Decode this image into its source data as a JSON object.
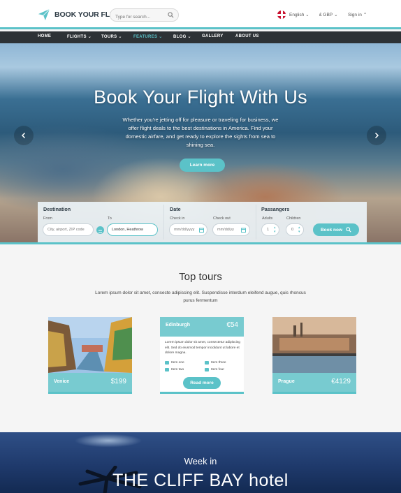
{
  "header": {
    "logo_text": "BOOK YOUR FLIGHT",
    "search_placeholder": "Type for search...",
    "language": "English",
    "currency": "£ GBP",
    "signin": "Sign in"
  },
  "nav": {
    "items": [
      "HOME",
      "FLIGHTS",
      "TOURS",
      "FEATURES",
      "BLOG",
      "GALLERY",
      "ABOUT US"
    ],
    "active": "FEATURES"
  },
  "hero": {
    "title": "Book Your Flight With Us",
    "text": "Whether you're jetting off for pleasure or traveling for business, we offer flight deals to the best destinations in America. Find your domestic airfare, and get ready to explore the sights from sea to shining sea.",
    "button": "Learn more"
  },
  "booking": {
    "destination_label": "Destination",
    "from_label": "From",
    "from_placeholder": "City, airport, ZIP code",
    "to_label": "To",
    "to_value": "London, Heathrow",
    "date_label": "Date",
    "checkin_label": "Check in",
    "checkin_placeholder": "mm/dd/yyyy",
    "checkout_label": "Check out",
    "checkout_placeholder": "mm/dd/yy",
    "passengers_label": "Passangers",
    "adults_label": "Adults",
    "adults_value": "1",
    "children_label": "Children",
    "children_value": "0",
    "book_button": "Book now"
  },
  "tours": {
    "title": "Top tours",
    "subtitle": "Lorem ipsum dolor sit amet, consecte adipiscing elit. Suspendisse interdum eleifend augue, quis rhoncus purus fermentum",
    "cards": [
      {
        "name": "Venice",
        "price": "$199"
      },
      {
        "name": "Edinburgh",
        "price": "€54",
        "description": "Lorem ipsum dolor sit amet, consectetur adipiscing elit. Sed do eiusmod tempor incididunt ut labore et dolore magna.",
        "features": [
          "Item one",
          "Item three",
          "Item two",
          "Item four"
        ],
        "button": "Read more"
      },
      {
        "name": "Prague",
        "price": "€4129"
      }
    ]
  },
  "promo": {
    "small": "Week in",
    "big": "THE CLIFF BAY hotel"
  },
  "colors": {
    "accent": "#5bc2c8",
    "nav_bg": "#2d3236"
  }
}
